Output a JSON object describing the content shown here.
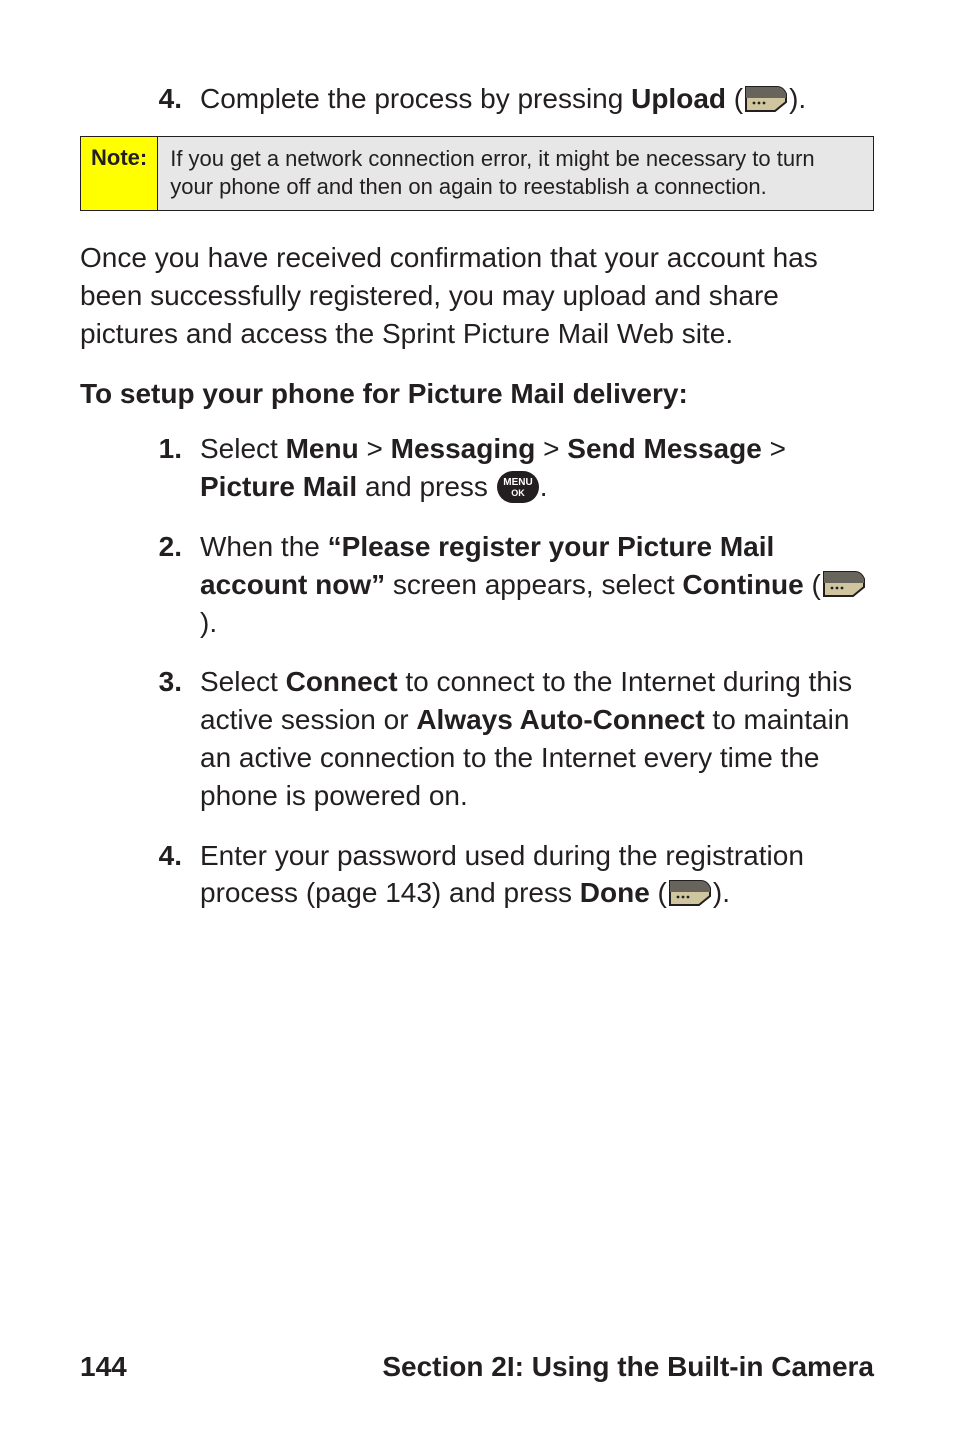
{
  "first_list": {
    "item4": {
      "num": "4.",
      "pre": "Complete the process by pressing ",
      "bold": "Upload",
      "open": " (",
      "close": ")."
    }
  },
  "note": {
    "label": "Note:",
    "body": "If you get a network connection error, it might be necessary to turn your phone off and then on again to reestablish a connection."
  },
  "paragraph": "Once you have received confirmation that your account has been successfully registered, you may upload and share pictures and access the Sprint Picture Mail Web site.",
  "subheading": "To setup your phone for Picture Mail delivery:",
  "second_list": {
    "item1": {
      "num": "1.",
      "t1": "Select ",
      "b1": "Menu",
      "t2": " > ",
      "b2": "Messaging",
      "t3": " > ",
      "b3": "Send Message",
      "t4": " > ",
      "b4": "Picture Mail",
      "t5": " and press ",
      "t6": "."
    },
    "item2": {
      "num": "2.",
      "t1": "When the ",
      "b1": "“Please register your Picture Mail account now”",
      "t2": " screen appears, select ",
      "b2": "Continue",
      "open": " (",
      "close": ")."
    },
    "item3": {
      "num": "3.",
      "t1": "Select ",
      "b1": "Connect",
      "t2": " to connect to the Internet during this active session or ",
      "b2": "Always Auto-Connect",
      "t3": " to maintain an active connection to the Internet every time the phone is powered on."
    },
    "item4": {
      "num": "4.",
      "t1": "Enter your password used during the registration process (page 143) and press ",
      "b1": "Done",
      "open": " (",
      "close": ")."
    }
  },
  "footer": {
    "page": "144",
    "section": "Section 2I: Using the Built-in Camera"
  }
}
